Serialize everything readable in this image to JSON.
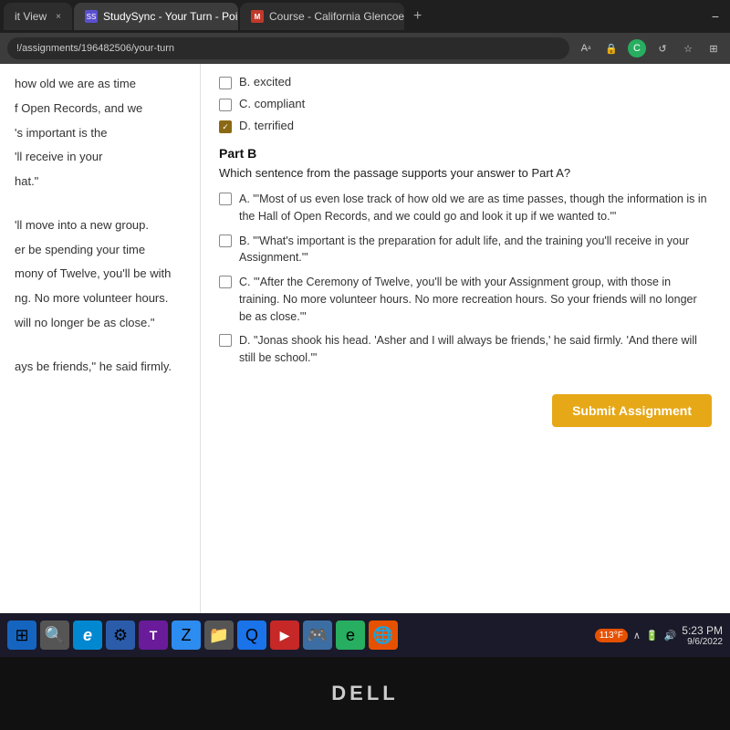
{
  "browser": {
    "tabs": [
      {
        "id": "t1",
        "label": "it View",
        "active": false,
        "icon": ""
      },
      {
        "id": "t2",
        "label": "StudySync - Your Turn - Point of",
        "active": true,
        "icon": "studysync"
      },
      {
        "id": "t3",
        "label": "Course - California Glencoe Mat",
        "active": false,
        "icon": "mcourse"
      }
    ],
    "url": "!/assignments/196482506/your-turn",
    "icons": [
      "A",
      "🔒",
      "C",
      "↺",
      "☆",
      "⊞"
    ]
  },
  "left_panel": {
    "lines": [
      "how old we are as time",
      "f Open Records, and we",
      "'s important is the",
      "'ll receive in your",
      "hat.\"",
      "'ll move into a new group.",
      "er be spending your time",
      "mony of Twelve, you'll be with",
      "ng. No more volunteer hours.",
      "will no longer be as close.\"",
      "ays be friends,\" he said firmly."
    ]
  },
  "right_panel": {
    "part_a_choices": [
      {
        "id": "A",
        "text": "B. excited",
        "checked": false
      },
      {
        "id": "B",
        "text": "C. compliant",
        "checked": false
      },
      {
        "id": "C",
        "text": "D. terrified",
        "checked": true
      }
    ],
    "part_b": {
      "heading": "Part B",
      "question": "Which sentence from the passage supports your answer to Part A?",
      "choices": [
        {
          "id": "A",
          "text": "A. \"'Most of us even lose track of how old we are as time passes, though the information is in the Hall of Open Records, and we could go and look it up if we wanted to.'\""
        },
        {
          "id": "B",
          "text": "B. \"'What's important is the preparation for adult life, and the training you'll receive in your Assignment.'\""
        },
        {
          "id": "C",
          "text": "C. \"'After the Ceremony of Twelve, you'll be with your Assignment group, with those in training. No more volunteer hours. No more recreation hours. So your friends will no longer be as close.'\""
        },
        {
          "id": "D",
          "text": "D. \"Jonas shook his head. 'Asher and I will always be friends,' he said firmly. 'And there will still be school.'\""
        }
      ]
    },
    "submit_button": "Submit Assignment"
  },
  "taskbar": {
    "icons": [
      {
        "name": "start-icon",
        "symbol": "⊞",
        "color": "blue"
      },
      {
        "name": "search-icon",
        "symbol": "🔍",
        "color": "blue"
      },
      {
        "name": "edge-icon",
        "symbol": "e",
        "color": "blue2"
      },
      {
        "name": "settings-icon",
        "symbol": "⚙",
        "color": "green"
      },
      {
        "name": "teams-icon",
        "symbol": "T",
        "color": "purple"
      },
      {
        "name": "zoom-icon",
        "symbol": "Z",
        "color": "blue"
      },
      {
        "name": "folder-icon",
        "symbol": "📁",
        "color": "yellow"
      },
      {
        "name": "chrome-icon",
        "symbol": "C",
        "color": "orange"
      },
      {
        "name": "youtube-icon",
        "symbol": "▶",
        "color": "red"
      },
      {
        "name": "game-icon",
        "symbol": "🎮",
        "color": "teal"
      },
      {
        "name": "app1-icon",
        "symbol": "e",
        "color": "blue2"
      },
      {
        "name": "app2-icon",
        "symbol": "🌐",
        "color": "orange"
      }
    ],
    "temp": "113°F",
    "time": "5:23 PM",
    "date": "9/6/2022"
  },
  "dell": {
    "logo": "DELL"
  }
}
